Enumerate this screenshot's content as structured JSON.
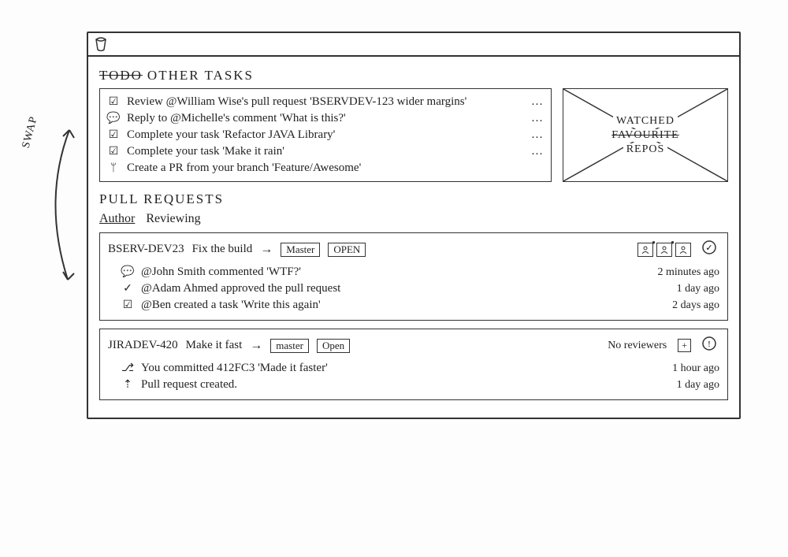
{
  "annotations": {
    "swap": "SWAP"
  },
  "headings": {
    "other_tasks_strike": "TODO",
    "other_tasks": "OTHER TASKS",
    "pull_requests": "PULL REQUESTS"
  },
  "tasks": [
    {
      "icon": "review-icon",
      "glyph": "☑",
      "text": "Review @William Wise's pull request 'BSERVDEV-123 wider margins'",
      "more": "…"
    },
    {
      "icon": "reply-icon",
      "glyph": "💬",
      "text": "Reply to @Michelle's comment 'What is this?'",
      "more": "…"
    },
    {
      "icon": "task-icon",
      "glyph": "☑",
      "text": "Complete your task 'Refactor JAVA Library'",
      "more": "…"
    },
    {
      "icon": "task-icon",
      "glyph": "☑",
      "text": "Complete your task 'Make it rain'",
      "more": "…"
    },
    {
      "icon": "branch-icon",
      "glyph": "ᛘ",
      "text": "Create a PR from your branch 'Feature/Awesome'",
      "more": ""
    }
  ],
  "repos_panel": {
    "line1": "WATCHED",
    "line2_strike": "FAVOURITE",
    "line3": "REPOS"
  },
  "tabs": [
    {
      "label": "Author",
      "active": true
    },
    {
      "label": "Reviewing",
      "active": false
    }
  ],
  "pull_requests": [
    {
      "key": "BSERV-DEV23",
      "title": "Fix the build",
      "target_branch": "Master",
      "state": "OPEN",
      "reviewers": {
        "mode": "avatars",
        "count": 3
      },
      "status_glyph": "✓",
      "activity": [
        {
          "glyph": "💬",
          "text": "@John Smith commented 'WTF?'",
          "time": "2 minutes ago"
        },
        {
          "glyph": "✓",
          "text": "@Adam Ahmed approved the pull request",
          "time": "1 day ago"
        },
        {
          "glyph": "☑",
          "text": "@Ben created a task 'Write this again'",
          "time": "2 days ago"
        }
      ]
    },
    {
      "key": "JIRADEV-420",
      "title": "Make it fast",
      "target_branch": "master",
      "state": "Open",
      "reviewers": {
        "mode": "none",
        "label": "No reviewers"
      },
      "status_glyph": "!",
      "activity": [
        {
          "glyph": "⎇",
          "text": "You committed 412FC3 'Made it faster'",
          "time": "1 hour ago"
        },
        {
          "glyph": "⇡",
          "text": "Pull request created.",
          "time": "1 day ago"
        }
      ]
    }
  ]
}
